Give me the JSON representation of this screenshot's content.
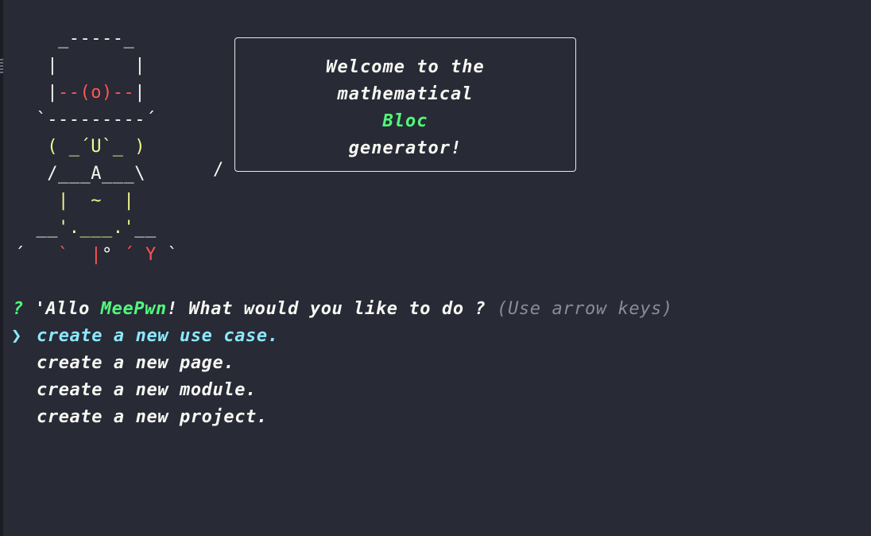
{
  "ascii_art": {
    "lines": [
      [
        {
          "t": "    _-----_",
          "c": "white"
        }
      ],
      [
        {
          "t": "   |       |",
          "c": "white"
        }
      ],
      [
        {
          "t": "   |",
          "c": "white"
        },
        {
          "t": "--(o)--",
          "c": "red"
        },
        {
          "t": "|",
          "c": "white"
        }
      ],
      [
        {
          "t": "  `---------´",
          "c": "white"
        }
      ],
      [
        {
          "t": "   ",
          "c": "white"
        },
        {
          "t": "( _´U`_ )",
          "c": "yellow"
        }
      ],
      [
        {
          "t": "   /___A___\\",
          "c": "white"
        }
      ],
      [
        {
          "t": "    ",
          "c": "white"
        },
        {
          "t": "|  ~  |",
          "c": "yellow"
        }
      ],
      [
        {
          "t": "  __",
          "c": "white"
        },
        {
          "t": "'.___.'",
          "c": "yellow"
        },
        {
          "t": "__",
          "c": "white"
        }
      ],
      [
        {
          "t": "´   ",
          "c": "white"
        },
        {
          "t": "`  |",
          "c": "red"
        },
        {
          "t": "° ",
          "c": "white"
        },
        {
          "t": "´ Y",
          "c": "red"
        },
        {
          "t": " `",
          "c": "white"
        }
      ]
    ],
    "tail": "/"
  },
  "bubble": {
    "line1": "Welcome to the",
    "line2": "mathematical",
    "line3": "Bloc",
    "line4": "generator!"
  },
  "prompt": {
    "marker": "?",
    "prefix": " 'Allo ",
    "name": "MeePwn",
    "question": "! What would you like to do ?",
    "hint": " (Use arrow keys)"
  },
  "menu": {
    "pointer": "❯",
    "items": [
      {
        "label": "create a new use case.",
        "selected": true
      },
      {
        "label": "create a new page.",
        "selected": false
      },
      {
        "label": "create a new module.",
        "selected": false
      },
      {
        "label": "create a new project.",
        "selected": false
      }
    ]
  },
  "colors": {
    "background": "#282a36",
    "green": "#50fa7b",
    "cyan": "#8be9fd",
    "red": "#ff5555",
    "yellow": "#f1fa8c",
    "hint": "#8a8d99"
  }
}
